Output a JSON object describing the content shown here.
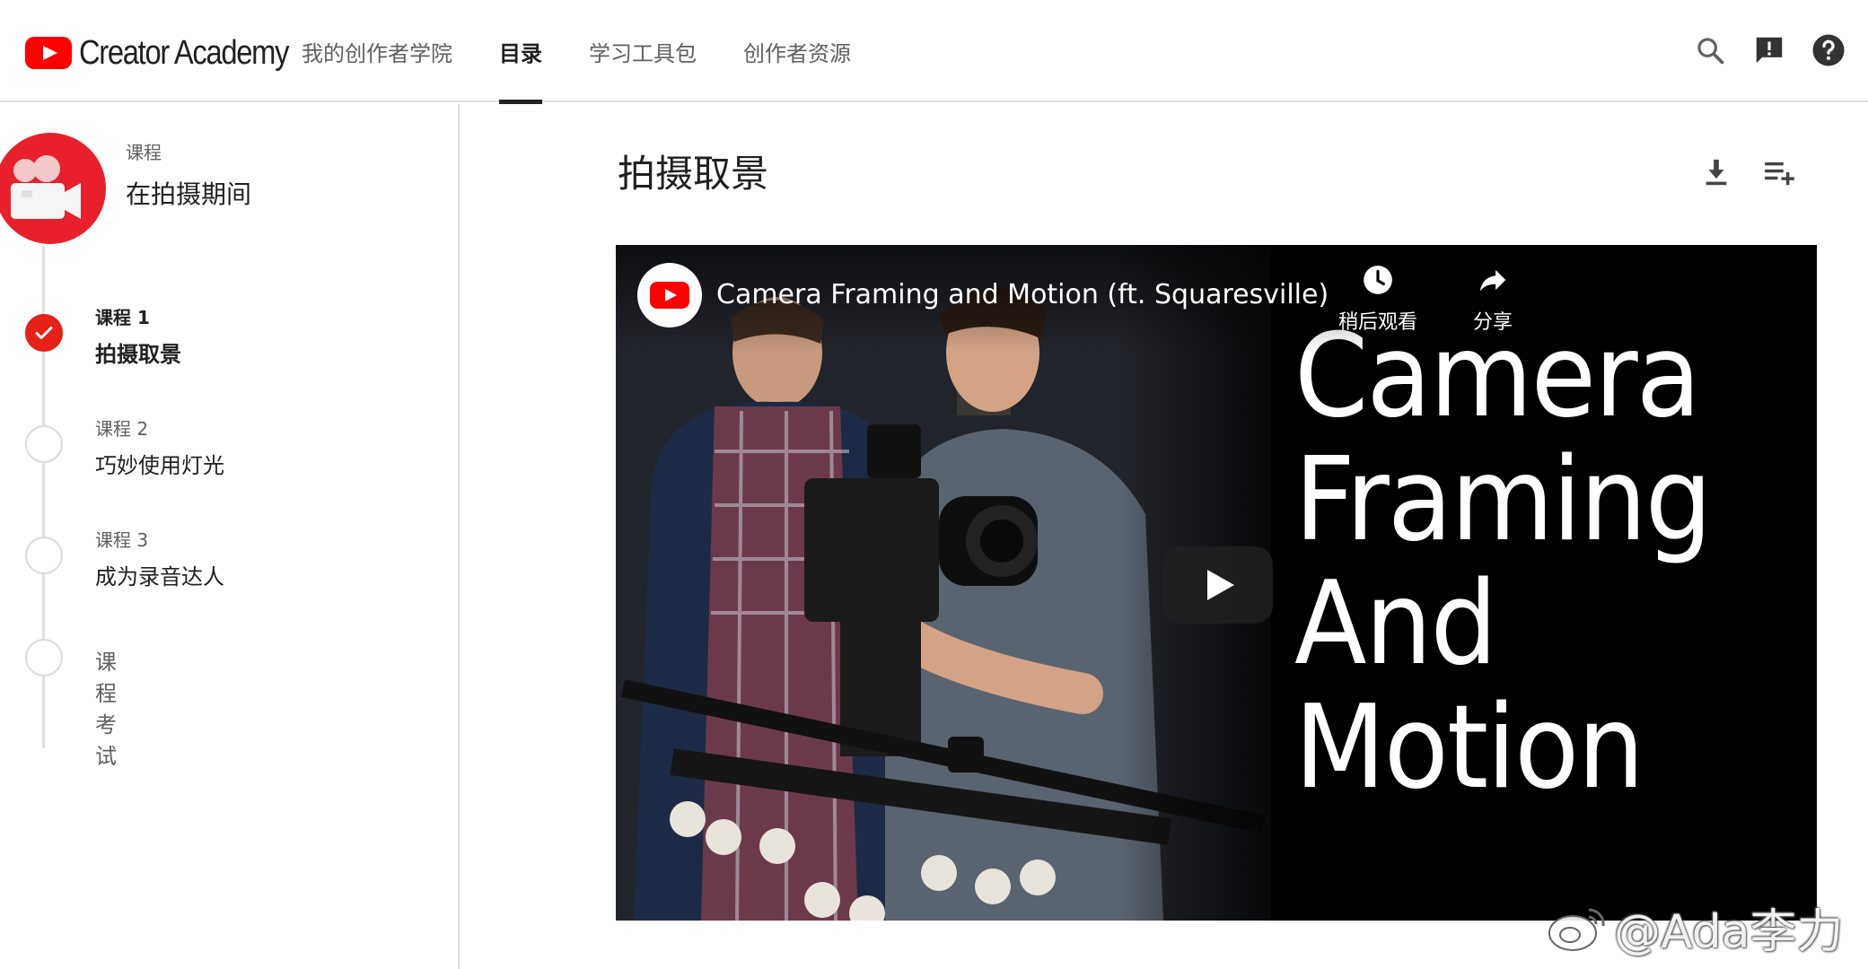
{
  "header": {
    "logo_text": "Creator Academy",
    "tabs": [
      {
        "label": "我的创作者学院"
      },
      {
        "label": "目录"
      },
      {
        "label": "学习工具包"
      },
      {
        "label": "创作者资源"
      }
    ],
    "active_tab": "目录",
    "icons": [
      "search-icon",
      "feedback-icon",
      "help-icon"
    ]
  },
  "sidebar": {
    "course_kicker": "课程",
    "course_title": "在拍摄期间",
    "badge_icon": "video-camera-icon",
    "lessons": [
      {
        "num": "课程 1",
        "name": "拍摄取景",
        "status": "completed"
      },
      {
        "num": "课程 2",
        "name": "巧妙使用灯光",
        "status": "not-started"
      },
      {
        "num": "课程 3",
        "name": "成为录音达人",
        "status": "not-started"
      }
    ],
    "exam": {
      "label": "课程考试"
    }
  },
  "main": {
    "title": "拍摄取景",
    "icons": [
      "download-icon",
      "playlist-add-icon"
    ]
  },
  "video": {
    "title": "Camera Framing and Motion (ft. Squaresville)",
    "overlay_lines": [
      "Camera",
      "Framing",
      "And",
      "Motion"
    ],
    "watch_later_label": "稍后观看",
    "share_label": "分享",
    "play_icon": "play-icon"
  },
  "watermark": {
    "text": "@Ada李力"
  },
  "colors": {
    "brand_red": "#ff0000",
    "completed": "#e62117",
    "text": "#212121",
    "muted": "#606060"
  }
}
